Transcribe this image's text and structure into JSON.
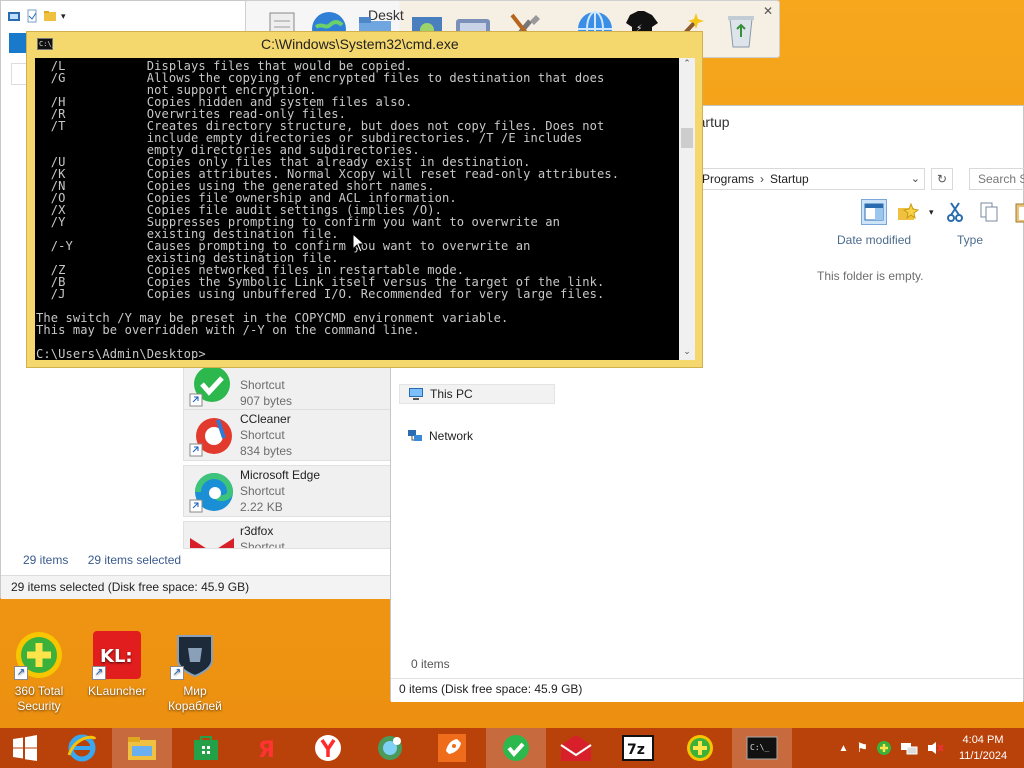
{
  "left_window": {
    "items": [
      {
        "name": "",
        "type": "Shortcut",
        "size": "907 bytes"
      },
      {
        "name": "CCleaner",
        "type": "Shortcut",
        "size": "834 bytes"
      },
      {
        "name": "Microsoft Edge",
        "type": "Shortcut",
        "size": "2.22 KB"
      },
      {
        "name": "r3dfox",
        "type": "Shortcut",
        "size": ""
      }
    ],
    "item_count": "29 items",
    "selected_count": "29 items selected",
    "status_bar": "29 items selected (Disk free space: 45.9 GB)"
  },
  "right_window": {
    "title": "Startup",
    "breadcrumb": [
      "Programs",
      "Startup"
    ],
    "search_placeholder": "Search St",
    "columns": [
      "Date modified",
      "Type"
    ],
    "empty_message": "This folder is empty.",
    "nav": [
      "This PC",
      "Network"
    ],
    "item_count": "0 items",
    "status_bar": "0 items (Disk free space: 45.9 GB)"
  },
  "floating_toolbar": {
    "partial_text": "Deskt"
  },
  "cmd": {
    "title": "C:\\Windows\\System32\\cmd.exe",
    "lines": [
      "  /L           Displays files that would be copied.",
      "  /G           Allows the copying of encrypted files to destination that does",
      "               not support encryption.",
      "  /H           Copies hidden and system files also.",
      "  /R           Overwrites read-only files.",
      "  /T           Creates directory structure, but does not copy files. Does not",
      "               include empty directories or subdirectories. /T /E includes",
      "               empty directories and subdirectories.",
      "  /U           Copies only files that already exist in destination.",
      "  /K           Copies attributes. Normal Xcopy will reset read-only attributes.",
      "  /N           Copies using the generated short names.",
      "  /O           Copies file ownership and ACL information.",
      "  /X           Copies file audit settings (implies /O).",
      "  /Y           Suppresses prompting to confirm you want to overwrite an",
      "               existing destination file.",
      "  /-Y          Causes prompting to confirm you want to overwrite an",
      "               existing destination file.",
      "  /Z           Copies networked files in restartable mode.",
      "  /B           Copies the Symbolic Link itself versus the target of the link.",
      "  /J           Copies using unbuffered I/O. Recommended for very large files.",
      "",
      "The switch /Y may be preset in the COPYCMD environment variable.",
      "This may be overridden with /-Y on the command line.",
      "",
      "C:\\Users\\Admin\\Desktop>"
    ]
  },
  "desktop_icons": [
    {
      "label": "360 Total Security",
      "color": "#f7c600",
      "icon": "plus-shield-icon"
    },
    {
      "label": "KLauncher",
      "color": "#e21d1d",
      "icon": "klauncher-icon"
    },
    {
      "label": "Мир Кораблей",
      "color": "#1c2a3a",
      "icon": "ship-icon"
    }
  ],
  "taskbar": {
    "clock_time": "4:04 PM",
    "clock_date": "11/1/2024",
    "apps": [
      "start-icon",
      "ie-icon",
      "explorer-icon",
      "store-icon",
      "yandex-icon",
      "yandex-browser-icon",
      "globe-app-icon",
      "rocket-icon",
      "check-shield-icon",
      "mail-icon",
      "7zip-icon",
      "360-icon",
      "cmd-icon"
    ]
  },
  "colors": {
    "desktop": "#f39e17",
    "taskbar": "#b8420a",
    "cmd_frame": "#f4d76d",
    "accent_blue": "#1979ca"
  }
}
